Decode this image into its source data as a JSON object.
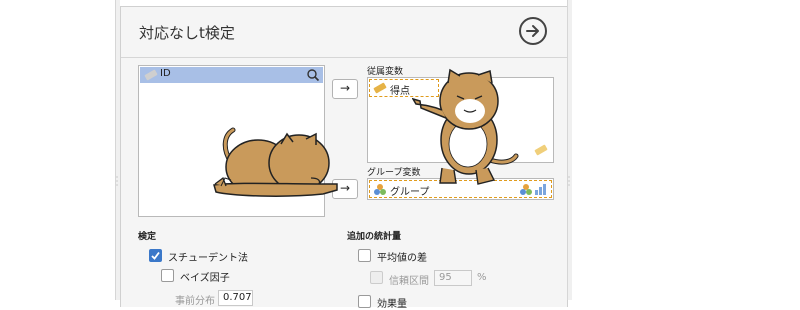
{
  "title": "対応なしt検定",
  "variables_list": {
    "item_label": "ID"
  },
  "dependent": {
    "label": "従属変数",
    "item": "得点"
  },
  "grouping": {
    "label": "グループ変数",
    "item": "グループ"
  },
  "tests": {
    "heading": "検定",
    "student": "スチューデント法",
    "bayes": "ベイズ因子",
    "prior_label": "事前分布",
    "prior_value": "0.707"
  },
  "additional": {
    "heading": "追加の統計量",
    "mean_diff": "平均値の差",
    "ci_label": "信頼区間",
    "ci_value": "95",
    "ci_unit": "%",
    "effect_size": "効果量"
  },
  "arrow_glyph": "→",
  "colors": {
    "selected": "#a8bfe6",
    "accent": "#3b78c9",
    "dashed": "#e09b1c",
    "cat": "#c99a5b"
  }
}
